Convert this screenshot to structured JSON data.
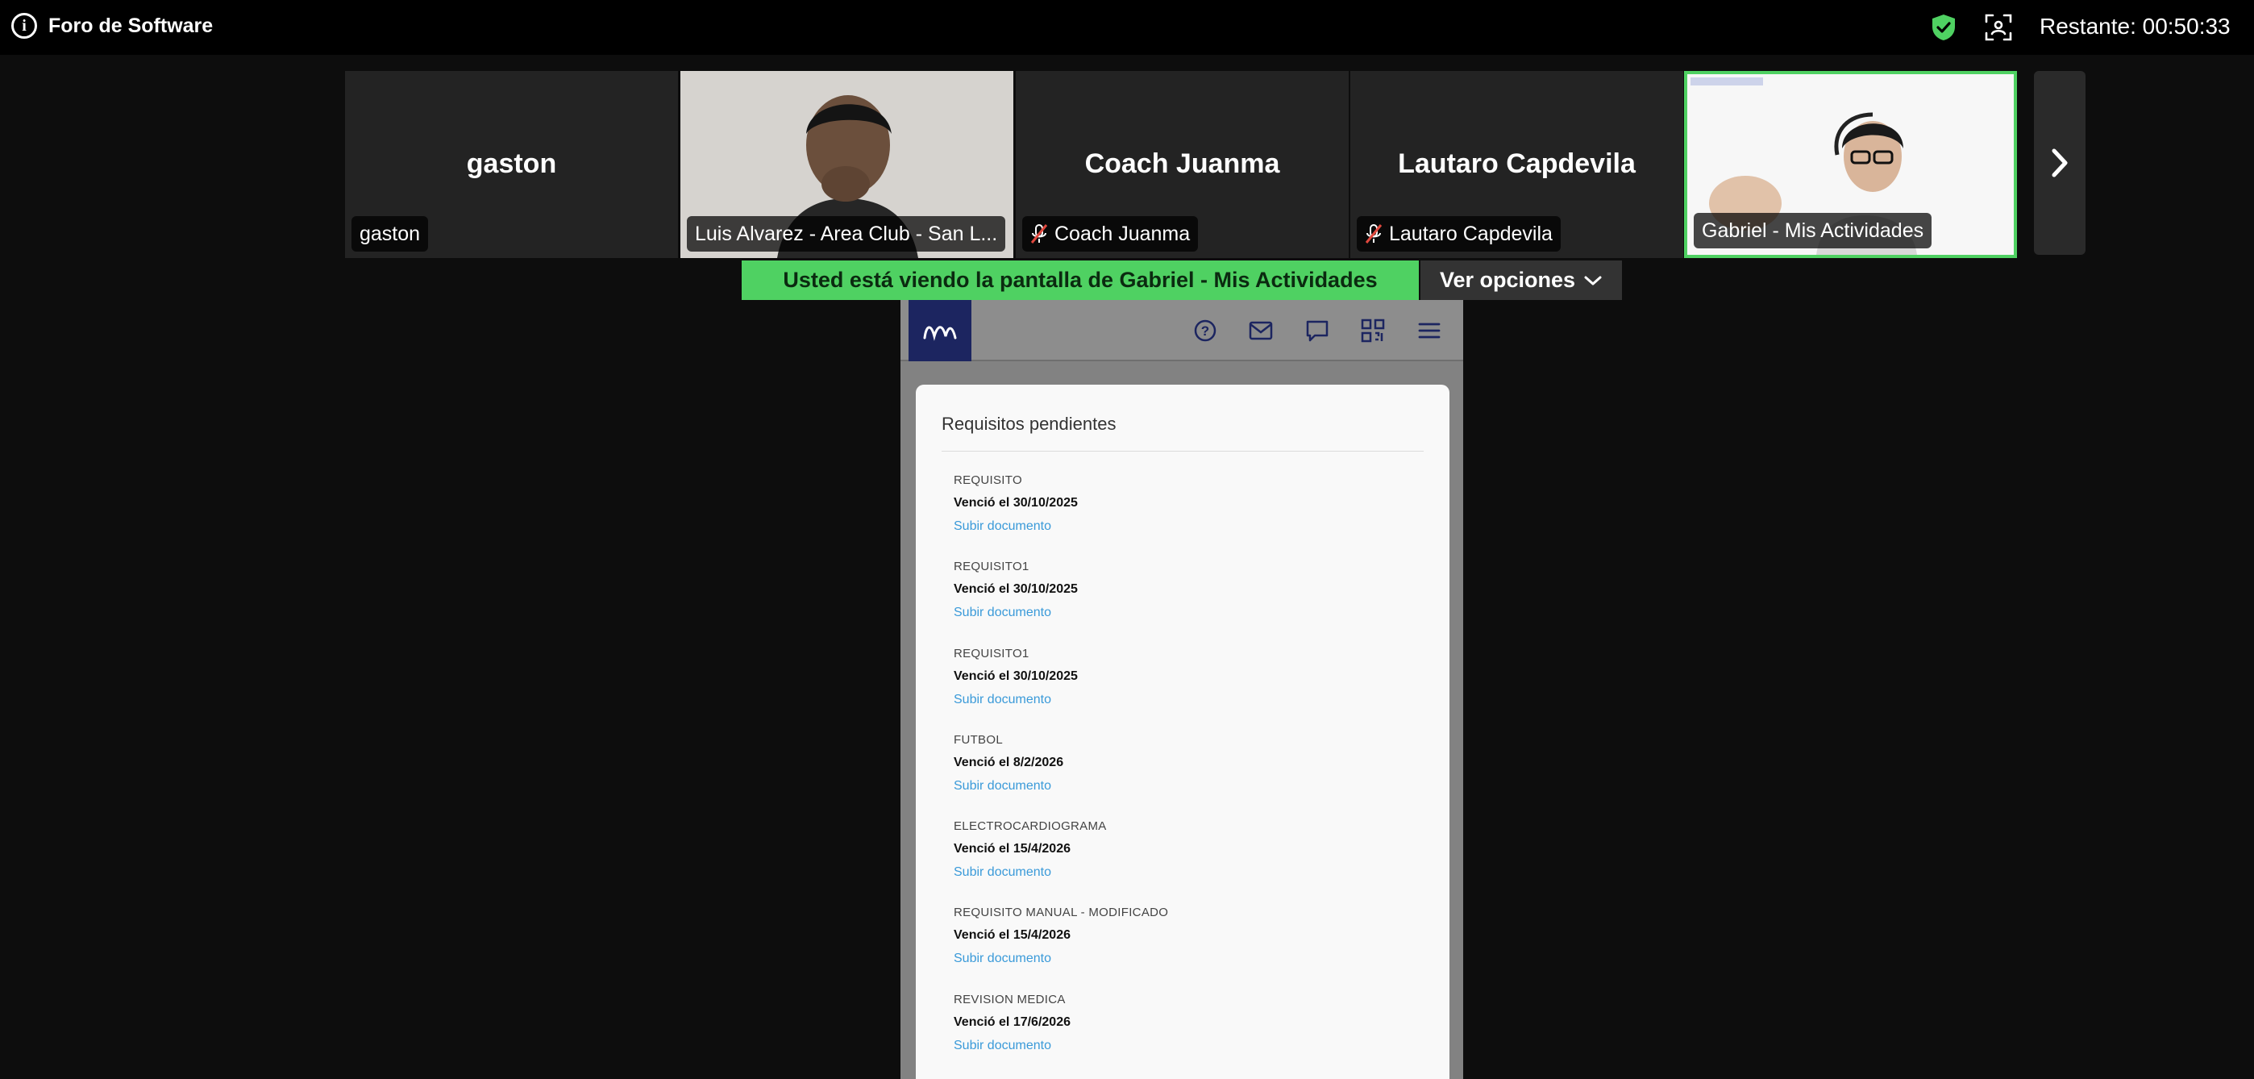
{
  "meeting": {
    "title": "Foro de Software",
    "remaining": "Restante: 00:50:33"
  },
  "participants": [
    {
      "big_name": "gaston",
      "label": "gaston",
      "muted": false,
      "video": false,
      "active": false
    },
    {
      "big_name": "",
      "label": "Luis Alvarez - Area Club - San L...",
      "muted": false,
      "video": true,
      "active": false
    },
    {
      "big_name": "Coach Juanma",
      "label": "Coach Juanma",
      "muted": true,
      "video": false,
      "active": false
    },
    {
      "big_name": "Lautaro Capdevila",
      "label": "Lautaro Capdevila",
      "muted": true,
      "video": false,
      "active": false
    },
    {
      "big_name": "",
      "label": "Gabriel - Mis Actividades",
      "muted": false,
      "video": true,
      "active": true
    }
  ],
  "share": {
    "banner": "Usted está viendo la pantalla de  Gabriel - Mis Actividades",
    "options_label": "Ver opciones"
  },
  "shared_screen": {
    "header_icons": [
      "help-icon",
      "mail-icon",
      "chat-icon",
      "qr-icon",
      "menu-icon"
    ],
    "card_title": "Requisitos pendientes",
    "requirements": [
      {
        "name": "REQUISITO",
        "due": "Venció el 30/10/2025",
        "action": "Subir documento"
      },
      {
        "name": "REQUISITO1",
        "due": "Venció el 30/10/2025",
        "action": "Subir documento"
      },
      {
        "name": "REQUISITO1",
        "due": "Venció el 30/10/2025",
        "action": "Subir documento"
      },
      {
        "name": "FUTBOL",
        "due": "Venció el 8/2/2026",
        "action": "Subir documento"
      },
      {
        "name": "ELECTROCARDIOGRAMA",
        "due": "Venció el 15/4/2026",
        "action": "Subir documento"
      },
      {
        "name": "REQUISITO MANUAL - MODIFICADO",
        "due": "Venció el 15/4/2026",
        "action": "Subir documento"
      },
      {
        "name": "REVISION MEDICA",
        "due": "Venció el 17/6/2026",
        "action": "Subir documento"
      }
    ]
  },
  "colors": {
    "share_green": "#4fd162",
    "link_blue": "#3a9ad9",
    "logo_navy": "#1c2560",
    "muted_red": "#e0483e"
  }
}
